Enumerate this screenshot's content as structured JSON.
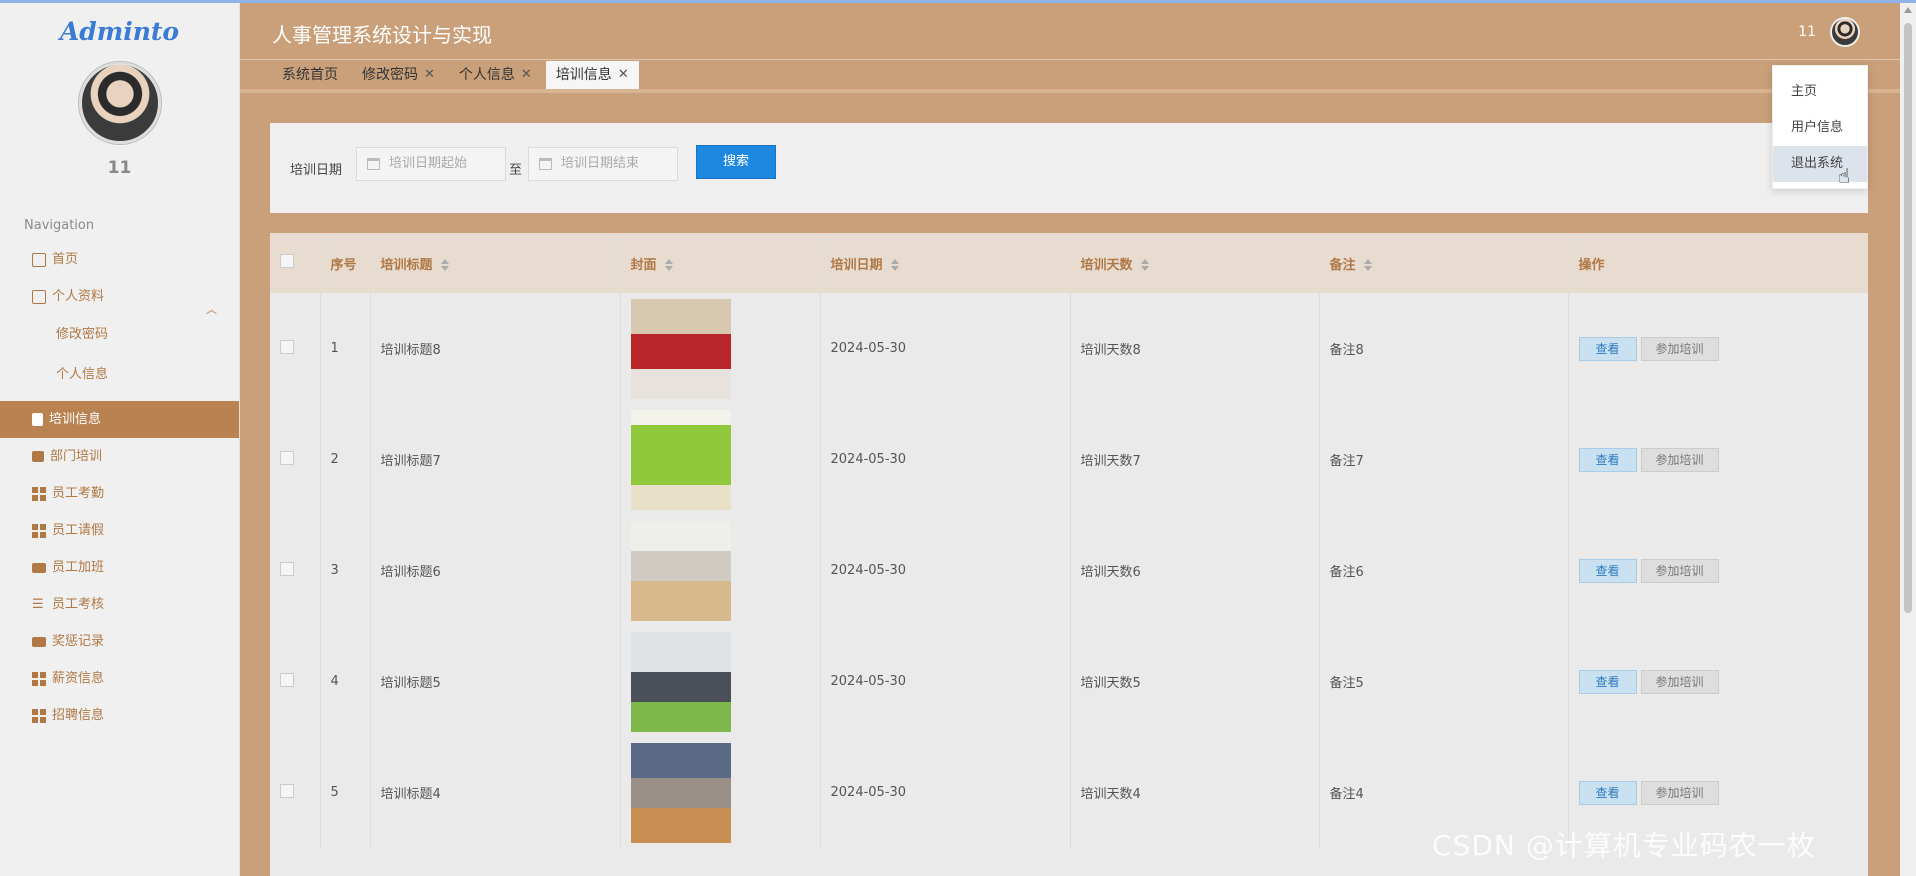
{
  "sidebar": {
    "logo": "Adminto",
    "user_name": "11",
    "nav_title": "Navigation",
    "items": [
      {
        "label": "首页",
        "icon": "home-icon"
      },
      {
        "label": "个人资料",
        "icon": "profile-icon",
        "expanded": true
      },
      {
        "label": "修改密码",
        "sub": true
      },
      {
        "label": "个人信息",
        "sub": true
      },
      {
        "label": "培训信息",
        "icon": "clipboard-icon",
        "active": true
      },
      {
        "label": "部门培训",
        "icon": "chart-icon"
      },
      {
        "label": "员工考勤",
        "icon": "grid-icon"
      },
      {
        "label": "员工请假",
        "icon": "grid-icon"
      },
      {
        "label": "员工加班",
        "icon": "ticket-icon"
      },
      {
        "label": "员工考核",
        "icon": "sliders-icon"
      },
      {
        "label": "奖惩记录",
        "icon": "monitor-icon"
      },
      {
        "label": "薪资信息",
        "icon": "grid-icon"
      },
      {
        "label": "招聘信息",
        "icon": "grid-icon"
      }
    ]
  },
  "header": {
    "title": "人事管理系统设计与实现",
    "user": "11"
  },
  "tabs": [
    {
      "label": "系统首页",
      "closable": false
    },
    {
      "label": "修改密码",
      "closable": true
    },
    {
      "label": "个人信息",
      "closable": true
    },
    {
      "label": "培训信息",
      "closable": true,
      "active": true
    }
  ],
  "search": {
    "label": "培训日期",
    "start_placeholder": "培训日期起始",
    "to": "至",
    "end_placeholder": "培训日期结束",
    "button": "搜索"
  },
  "table": {
    "headers": [
      "序号",
      "培训标题",
      "封面",
      "培训日期",
      "培训天数",
      "备注",
      "操作"
    ],
    "rows": [
      {
        "no": "1",
        "title": "培训标题8",
        "date": "2024-05-30",
        "days": "培训天数8",
        "note": "备注8"
      },
      {
        "no": "2",
        "title": "培训标题7",
        "date": "2024-05-30",
        "days": "培训天数7",
        "note": "备注7"
      },
      {
        "no": "3",
        "title": "培训标题6",
        "date": "2024-05-30",
        "days": "培训天数6",
        "note": "备注6"
      },
      {
        "no": "4",
        "title": "培训标题5",
        "date": "2024-05-30",
        "days": "培训天数5",
        "note": "备注5"
      },
      {
        "no": "5",
        "title": "培训标题4",
        "date": "2024-05-30",
        "days": "培训天数4",
        "note": "备注4"
      }
    ],
    "view_label": "查看",
    "join_label": "参加培训"
  },
  "dropdown": {
    "items": [
      "主页",
      "用户信息",
      "退出系统"
    ]
  },
  "watermark": "CSDN @计算机专业码农一枚",
  "colors": {
    "header_bg": "#c9a07a",
    "active_nav": "#b98250",
    "search_button": "#1e87e0"
  }
}
